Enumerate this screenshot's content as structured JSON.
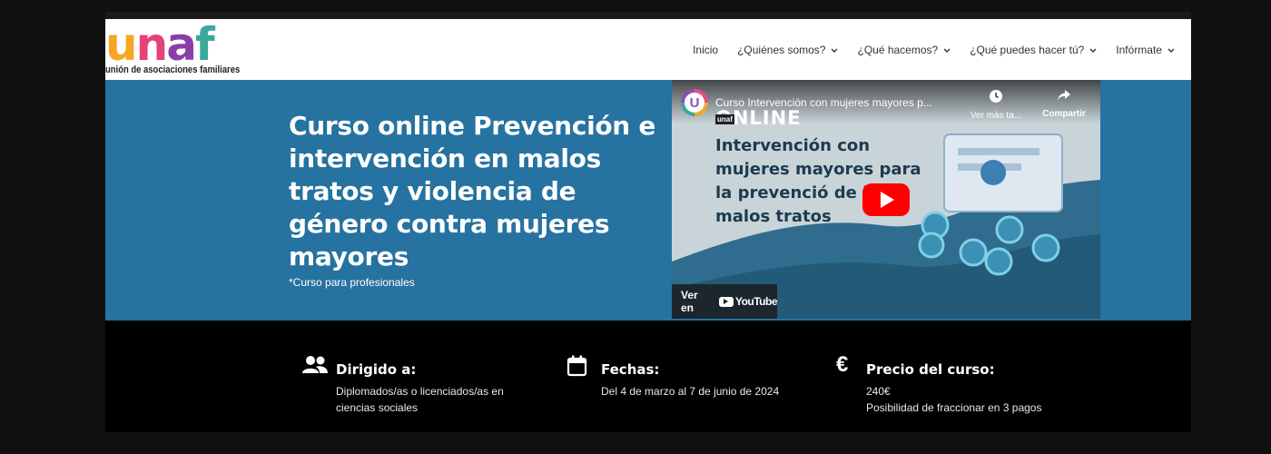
{
  "logo": {
    "letters": [
      "u",
      "n",
      "a",
      "f"
    ],
    "letter_colors": [
      "#f6a623",
      "#e6427a",
      "#8a3fa8",
      "#3aa89b"
    ],
    "tagline": "unión de asociaciones familiares"
  },
  "nav": {
    "items": [
      {
        "label": "Inicio",
        "dropdown": false
      },
      {
        "label": "¿Quiénes somos?",
        "dropdown": true
      },
      {
        "label": "¿Qué hacemos?",
        "dropdown": true
      },
      {
        "label": "¿Qué puedes hacer tú?",
        "dropdown": true
      },
      {
        "label": "Infórmate",
        "dropdown": true
      }
    ],
    "chevron": "⌄"
  },
  "hero": {
    "title": "Curso online Prevención e intervención en malos tratos y violencia de género contra mujeres mayores",
    "subtitle": "*Curso para profesionales",
    "bg_color": "#2672a0"
  },
  "video": {
    "channel_initial": "U",
    "title": "Curso Intervención con mujeres mayores p...",
    "watch_later_label": "Ver más ta...",
    "share_label": "Compartir",
    "badge": "unaf",
    "thumbnail_tag": "ONLINE",
    "thumbnail_headline": "Intervención con mujeres mayores para la prevenció de los malos tratos",
    "watch_on_label": "Ver en",
    "youtube_label": "YouTube",
    "icons": {
      "clock": "clock-icon",
      "share": "share-icon",
      "play": "play-icon"
    }
  },
  "info": {
    "columns": [
      {
        "icon": "people-icon",
        "heading": "Dirigido a:",
        "lines": [
          "Diplomados/as o licenciados/as en ciencias sociales"
        ]
      },
      {
        "icon": "calendar-icon",
        "heading": "Fechas:",
        "lines": [
          "Del 4 de marzo al 7 de junio de 2024"
        ]
      },
      {
        "icon": "euro-icon",
        "heading": "Precio del curso:",
        "lines": [
          "240€",
          "Posibilidad de fraccionar en 3 pagos"
        ]
      }
    ],
    "euro_symbol": "€"
  }
}
